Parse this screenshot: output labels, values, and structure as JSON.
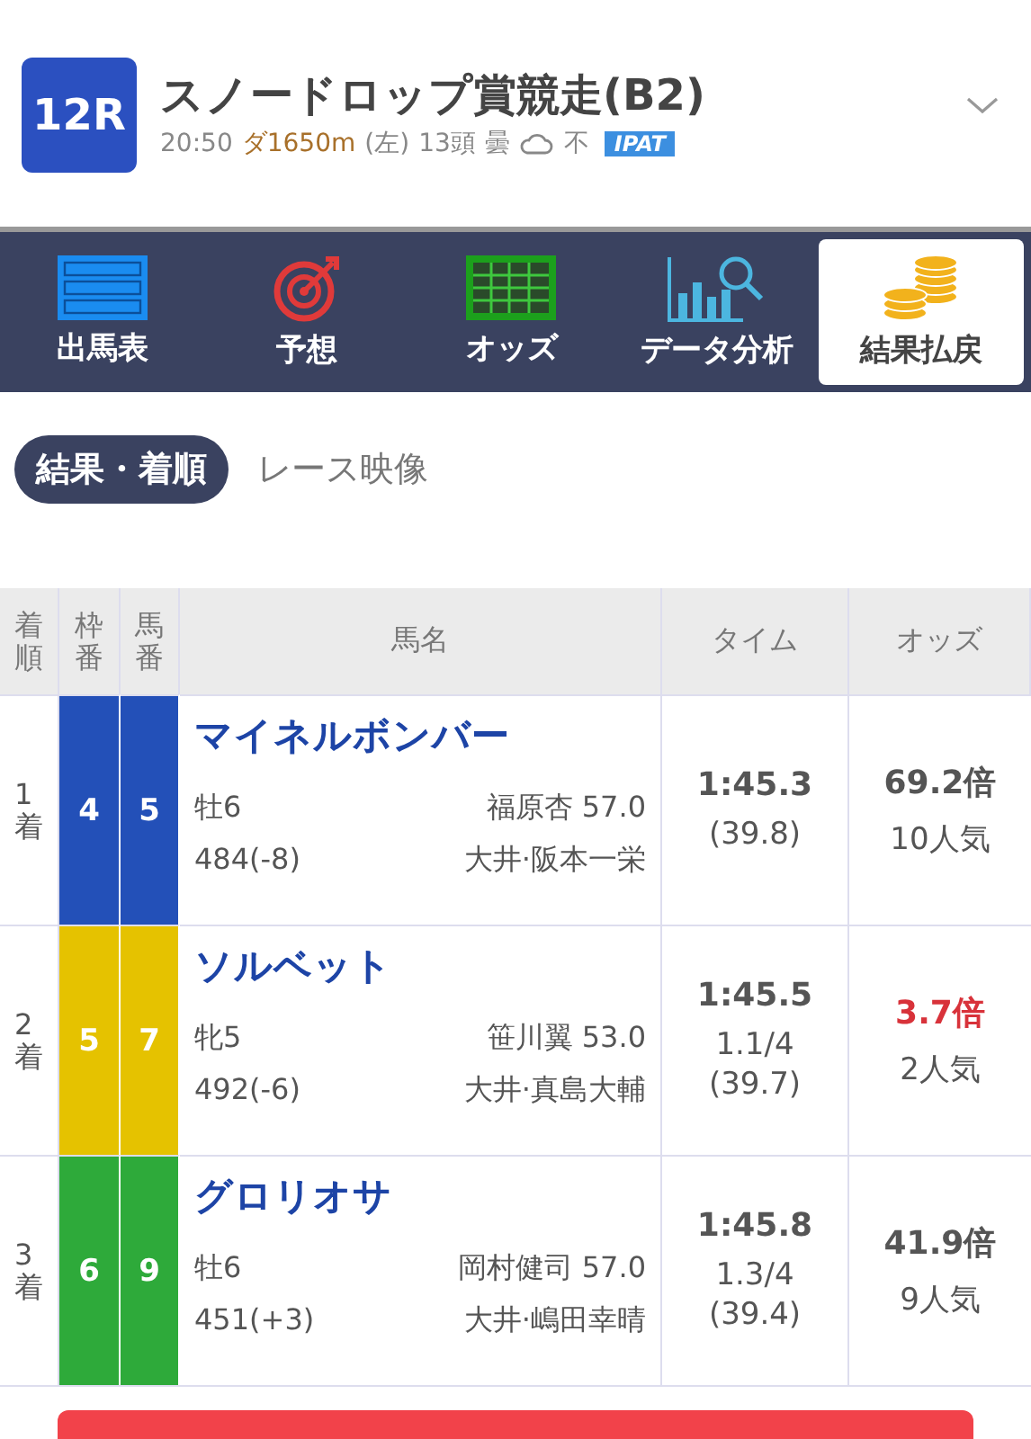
{
  "race": {
    "number": "12R",
    "title": "スノードロップ賞競走(B2)",
    "time": "20:50",
    "course": "ダ1650m",
    "direction": "(左)",
    "runners": "13頭",
    "weather": "曇",
    "going": "不",
    "badge": "IPAT"
  },
  "nav": [
    {
      "label": "出馬表",
      "kind": "list",
      "selected": false
    },
    {
      "label": "予想",
      "kind": "target",
      "selected": false
    },
    {
      "label": "オッズ",
      "kind": "grid",
      "selected": false
    },
    {
      "label": "データ分析",
      "kind": "chart",
      "selected": false
    },
    {
      "label": "結果払戻",
      "kind": "coins",
      "selected": true
    }
  ],
  "subtabs": [
    {
      "label": "結果・着順",
      "selected": true
    },
    {
      "label": "レース映像",
      "selected": false
    }
  ],
  "table": {
    "columns": [
      "着順",
      "枠番",
      "馬番",
      "馬名",
      "タイム",
      "オッズ"
    ],
    "rows": [
      {
        "place": "1着",
        "frame": "4",
        "number": "5",
        "color": "#2350b8",
        "name": "マイネルボンバー",
        "sex_age": "牡6",
        "jockey": "福原杏 57.0",
        "weight": "484(-8)",
        "trainer": "大井·阪本一栄",
        "time": "1:45.3",
        "last3f": "(39.8)",
        "odds": "69.2倍",
        "odds_highlight": false,
        "popularity": "10人気"
      },
      {
        "place": "2着",
        "frame": "5",
        "number": "7",
        "color": "#e5c200",
        "name": "ソルベット",
        "sex_age": "牝5",
        "jockey": "笹川翼 53.0",
        "weight": "492(-6)",
        "trainer": "大井·真島大輔",
        "time": "1:45.5",
        "margin": "1.1/4",
        "last3f": "(39.7)",
        "odds": "3.7倍",
        "odds_highlight": true,
        "popularity": "2人気"
      },
      {
        "place": "3着",
        "frame": "6",
        "number": "9",
        "color": "#2eaa3a",
        "name": "グロリオサ",
        "sex_age": "牡6",
        "jockey": "岡村健司 57.0",
        "weight": "451(+3)",
        "trainer": "大井·嶋田幸晴",
        "time": "1:45.8",
        "margin": "1.3/4",
        "last3f": "(39.4)",
        "odds": "41.9倍",
        "odds_highlight": false,
        "popularity": "9人気"
      }
    ]
  }
}
